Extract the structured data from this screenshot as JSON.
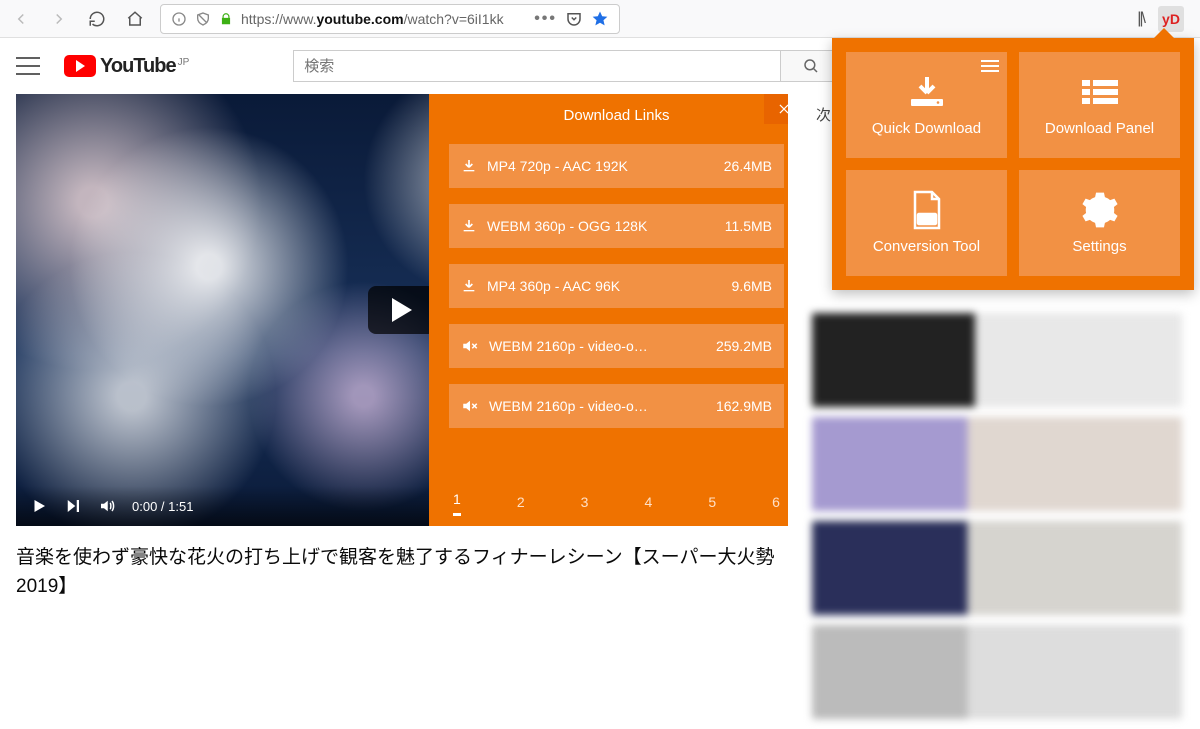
{
  "browser": {
    "url_prefix": "https://www.",
    "url_host": "youtube.com",
    "url_rest": "/watch?v=6iI1kk",
    "yd_label": "yD"
  },
  "yt": {
    "logo_text": "YouTube",
    "region": "JP",
    "search_placeholder": "検索"
  },
  "video": {
    "current_time": "0:00",
    "duration": "1:51",
    "title": "音楽を使わず豪快な花火の打ち上げで観客を魅了するフィナーレシーン【スーパー大火勢2019】"
  },
  "download_panel": {
    "title": "Download Links",
    "items": [
      {
        "icon": "download",
        "label": "MP4 720p - AAC 192K",
        "size": "26.4MB"
      },
      {
        "icon": "download",
        "label": "WEBM 360p - OGG 128K",
        "size": "11.5MB"
      },
      {
        "icon": "download",
        "label": "MP4 360p - AAC 96K",
        "size": "9.6MB"
      },
      {
        "icon": "mute",
        "label": "WEBM 2160p - video-o…",
        "size": "259.2MB"
      },
      {
        "icon": "mute",
        "label": "WEBM 2160p - video-o…",
        "size": "162.9MB"
      }
    ],
    "pages": [
      "1",
      "2",
      "3",
      "4",
      "5",
      "6"
    ],
    "active_page": "1"
  },
  "ext_popup": {
    "tiles": [
      {
        "label": "Quick Download"
      },
      {
        "label": "Download Panel"
      },
      {
        "label": "Conversion Tool"
      },
      {
        "label": "Settings"
      }
    ]
  },
  "sidebar": {
    "heading": "次"
  },
  "colors": {
    "accent": "#ef7200",
    "accent_light": "#f29144"
  }
}
